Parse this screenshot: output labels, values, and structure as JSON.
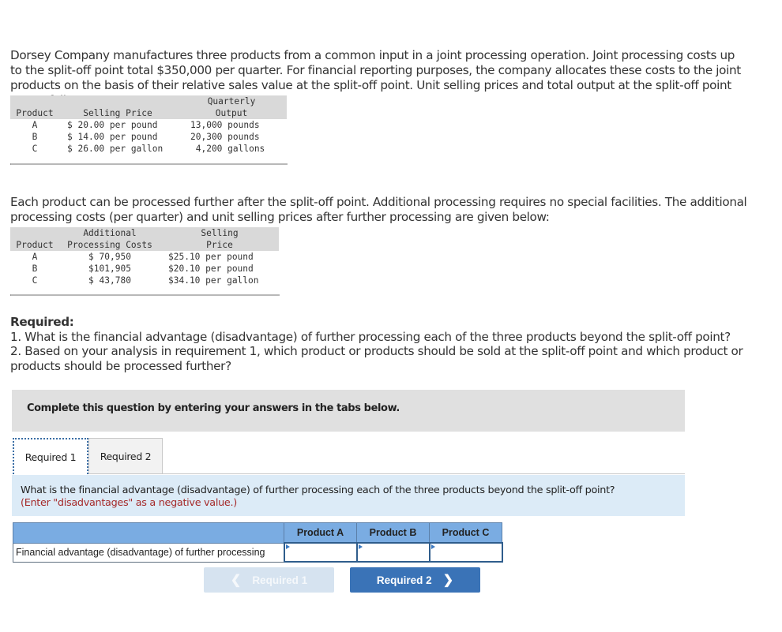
{
  "intro": "Dorsey Company manufactures three products from a common input in a joint processing operation. Joint processing costs up to the split-off point total $350,000 per quarter. For financial reporting purposes, the company allocates these costs to the joint products on the basis of their relative sales value at the split-off point. Unit selling prices and total output at the split-off point are as follows:",
  "table1": {
    "headers": {
      "product": "Product",
      "price": "Selling Price",
      "output_line1": "Quarterly",
      "output_line2": "Output"
    },
    "rows": [
      {
        "product": "A",
        "price": "$ 20.00 per pound",
        "output": "13,000 pounds"
      },
      {
        "product": "B",
        "price": "$ 14.00 per pound",
        "output": "20,300 pounds"
      },
      {
        "product": "C",
        "price": "$ 26.00 per gallon",
        "output": " 4,200 gallons"
      }
    ]
  },
  "para2": "Each product can be processed further after the split-off point. Additional processing requires no special facilities. The additional processing costs (per quarter) and unit selling prices after further processing are given below:",
  "table2": {
    "headers": {
      "product": "Product",
      "cost_line1": "Additional",
      "cost_line2": "Processing Costs",
      "price_line1": "Selling",
      "price_line2": "Price"
    },
    "rows": [
      {
        "product": "A",
        "cost": "$ 70,950",
        "price": "$25.10 per pound"
      },
      {
        "product": "B",
        "cost": "$101,905",
        "price": "$20.10 per pound"
      },
      {
        "product": "C",
        "cost": "$ 43,780",
        "price": "$34.10 per gallon"
      }
    ]
  },
  "required": {
    "heading": "Required:",
    "items": [
      "1. What is the financial advantage (disadvantage) of further processing each of the three products beyond the split-off point?",
      "2. Based on your analysis in requirement 1, which product or products should be sold at the split-off point and which product or products should be processed further?"
    ]
  },
  "banner": "Complete this question by entering your answers in the tabs below.",
  "tabs": [
    {
      "label": "Required 1",
      "active": true
    },
    {
      "label": "Required 2",
      "active": false
    }
  ],
  "question": {
    "text": "What is the financial advantage (disadvantage) of further processing each of the three products beyond the split-off point?",
    "note": "(Enter \"disadvantages\" as a negative value.)"
  },
  "answer_table": {
    "columns": [
      "Product A",
      "Product B",
      "Product C"
    ],
    "row_label": "Financial advantage (disadvantage) of further processing",
    "values": [
      "",
      "",
      ""
    ]
  },
  "nav": {
    "prev_label": "Required 1",
    "next_label": "Required 2",
    "prev_icon": "chevron-left-icon",
    "next_icon": "chevron-right-icon"
  },
  "colors": {
    "header_blue": "#7aace2",
    "next_button": "#3a73b7",
    "prev_button_disabled": "#d6e3f0",
    "note_red": "#a52a2a",
    "question_bg": "#dcebf7",
    "banner_bg": "#e0e0e0"
  }
}
